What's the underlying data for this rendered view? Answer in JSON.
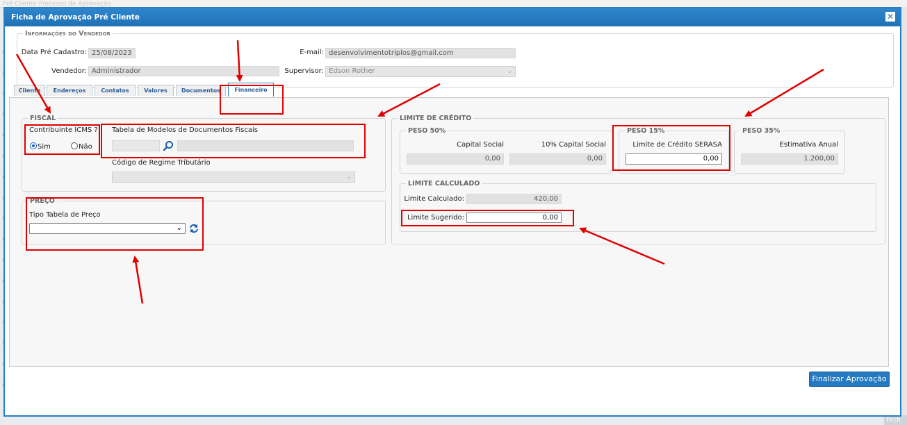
{
  "background": {
    "page_title": "Pré Cliente Processo de Aprovação",
    "corner_button": "Fech"
  },
  "dialog": {
    "title": "Ficha de Aprovação Pré Cliente",
    "close_glyph": "✕"
  },
  "vendedor_section": {
    "legend": "Informações do Vendedor",
    "data_label": "Data Pré Cadastro:",
    "data_value": "25/08/2023",
    "email_label": "E-mail:",
    "email_value": "desenvolvimentotriplos@gmail.com",
    "vendedor_label": "Vendedor:",
    "vendedor_value": "Administrador",
    "supervisor_label": "Supervisor:",
    "supervisor_value": "Edson Rother"
  },
  "tabs": [
    {
      "label": "Cliente"
    },
    {
      "label": "Endereços"
    },
    {
      "label": "Contatos"
    },
    {
      "label": "Valores"
    },
    {
      "label": "Documentos"
    },
    {
      "label": "Financeiro",
      "active": true
    }
  ],
  "fiscal": {
    "legend": "FISCAL",
    "icms_label": "Contribuinte ICMS ?",
    "sim_label": "Sim",
    "nao_label": "Não",
    "icms_selected": "Sim",
    "tabela_label": "Tabela de Modelos de Documentos Fiscais",
    "regime_label": "Código de Regime Tributário"
  },
  "preco": {
    "legend": "PREÇO",
    "tipo_label": "Tipo Tabela de Preço"
  },
  "limite_credito": {
    "legend": "LIMITE DE CRÉDITO",
    "peso50": {
      "legend": "PESO 50%",
      "capital_label": "Capital Social",
      "capital_value": "0,00",
      "capital10_label": "10% Capital Social",
      "capital10_value": "0,00"
    },
    "peso15": {
      "legend": "PESO 15%",
      "serasa_label": "Limite de Crédito SERASA",
      "serasa_value": "0,00"
    },
    "peso35": {
      "legend": "PESO 35%",
      "estimativa_label": "Estimativa Anual",
      "estimativa_value": "1.200,00"
    },
    "calculado": {
      "legend": "LIMITE CALCULADO",
      "calc_label": "Limite Calculado:",
      "calc_value": "420,00",
      "sugerido_label": "Limite Sugerido:",
      "sugerido_value": "0,00"
    }
  },
  "footer": {
    "finalizar_label": "Finalizar Aprovação"
  },
  "colors": {
    "accent": "#2a7fc3",
    "annotation": "#e00000"
  },
  "icons": [
    "close-icon",
    "search-icon",
    "refresh-icon",
    "chevron-down-icon"
  ]
}
